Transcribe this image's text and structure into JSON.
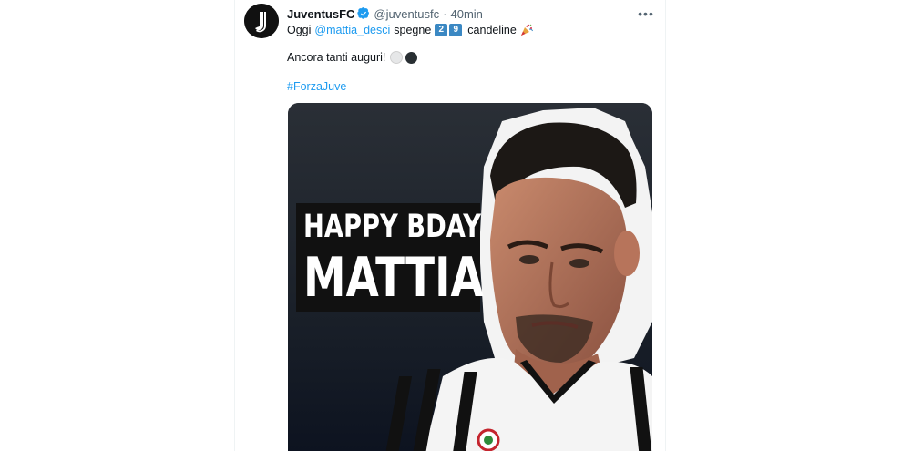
{
  "tweet": {
    "display_name": "JuventusFC",
    "handle": "@juventusfc",
    "separator": "·",
    "time": "40min",
    "more_icon": "more-horizontal-icon",
    "line1": {
      "prefix": "Oggi",
      "mention": "@mattia_desci",
      "verb": "spegne",
      "digit1": "2",
      "digit2": "9",
      "suffix": "candeline",
      "emoji": "party-popper-icon"
    },
    "line2": {
      "text": "Ancora tanti auguri!",
      "emoji": [
        "white-circle-icon",
        "black-circle-icon"
      ]
    },
    "hashtag": "#ForzaJuve",
    "media": {
      "headline1": "HAPPY BDAY",
      "headline2": "MATTIA"
    }
  },
  "colors": {
    "link": "#1d9bf0",
    "text": "#0f1419",
    "secondary": "#536471",
    "verified": "#1d9bf0",
    "keycap": "#3b88c3"
  }
}
